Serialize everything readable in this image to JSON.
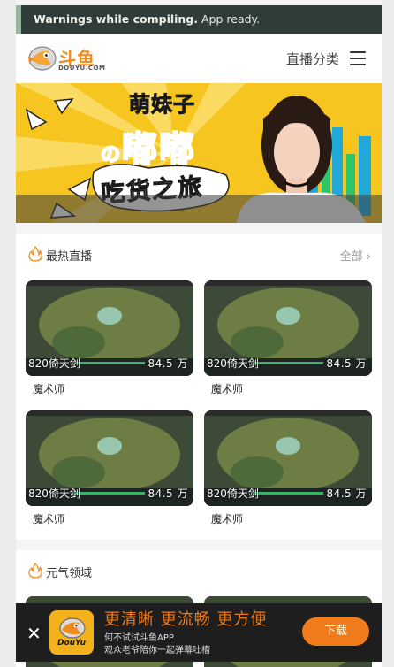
{
  "warning": {
    "bold": "Warnings while compiling.",
    "rest": " App ready."
  },
  "header": {
    "logo_text": "斗鱼",
    "logo_sub": "DOUYU.COM",
    "category_label": "直播分类"
  },
  "banner": {
    "line1": "萌妹子",
    "line2": "嘟嘟",
    "line2_prefix": "の",
    "line3": "吃货之旅"
  },
  "hot": {
    "title": "最热直播",
    "more_label": "全部 ›",
    "rooms": [
      {
        "anchor": "820倚天剑",
        "views": "84.5 万",
        "title": "魔术师"
      },
      {
        "anchor": "820倚天剑",
        "views": "84.5 万",
        "title": "魔术师"
      },
      {
        "anchor": "820倚天剑",
        "views": "84.5 万",
        "title": "魔术师"
      },
      {
        "anchor": "820倚天剑",
        "views": "84.5 万",
        "title": "魔术师"
      }
    ]
  },
  "section2": {
    "title": "元气领域"
  },
  "download": {
    "close": "✕",
    "logo_text": "DouYu",
    "headline": "更清晰 更流畅 更方便",
    "sub1": "何不试试斗鱼APP",
    "sub2": "观众老爷陪你一起弹幕吐槽",
    "button": "下载"
  },
  "colors": {
    "accent": "#f07b1a",
    "warning_bg": "#2f3c3a",
    "banner_bg": "#f7c51f"
  }
}
